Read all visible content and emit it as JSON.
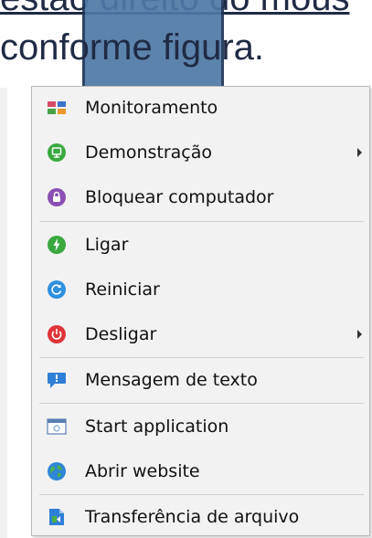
{
  "background": {
    "line1": "estão direito do mous",
    "line2": "conforme figura."
  },
  "menu": {
    "items": [
      {
        "label": "Monitoramento",
        "icon": "monitoring-grid-icon",
        "submenu": false
      },
      {
        "label": "Demonstração",
        "icon": "demonstration-icon",
        "submenu": true
      },
      {
        "label": "Bloquear computador",
        "icon": "lock-icon",
        "submenu": false
      },
      {
        "label": "Ligar",
        "icon": "power-on-icon",
        "submenu": false
      },
      {
        "label": "Reiniciar",
        "icon": "restart-icon",
        "submenu": false
      },
      {
        "label": "Desligar",
        "icon": "power-off-icon",
        "submenu": true
      },
      {
        "label": "Mensagem de texto",
        "icon": "message-icon",
        "submenu": false
      },
      {
        "label": "Start application",
        "icon": "application-window-icon",
        "submenu": false
      },
      {
        "label": "Abrir website",
        "icon": "globe-icon",
        "submenu": false
      },
      {
        "label": "Transferência de arquivo",
        "icon": "file-transfer-icon",
        "submenu": false
      }
    ]
  },
  "colors": {
    "menu_background": "#f2f2f2",
    "highlight_rect": "#4f79a6",
    "separator": "#cfcfcf"
  }
}
